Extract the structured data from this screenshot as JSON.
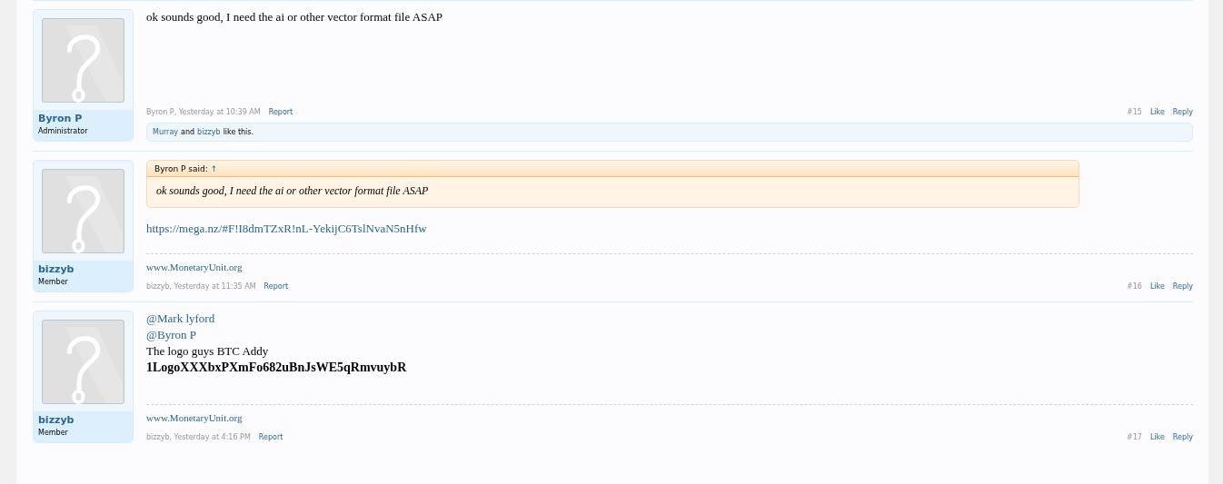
{
  "posts": [
    {
      "user": {
        "name": "Byron P",
        "role": "Administrator"
      },
      "body": [
        {
          "kind": "text",
          "text": "ok sounds good, I need the ai or other vector format file ASAP"
        }
      ],
      "meta": {
        "author": "Byron P, Yesterday at 10:39 AM",
        "report": "Report",
        "number": "#15",
        "like": "Like",
        "reply": "Reply"
      },
      "likes": {
        "first": "Murray",
        "and": "and",
        "second": "bizzyb",
        "tail": "like this."
      }
    },
    {
      "user": {
        "name": "bizzyb",
        "role": "Member"
      },
      "quote": {
        "attribution": "Byron P said:",
        "arrow": "↑",
        "text": "ok sounds good, I need the ai or other vector format file ASAP"
      },
      "body": [
        {
          "kind": "link",
          "text": "https://mega.nz/#F!I8dmTZxR!nL-YekijC6TslNvaN5nHfw"
        }
      ],
      "signature": "www.MonetaryUnit.org",
      "meta": {
        "author": "bizzyb, Yesterday at 11:35 AM",
        "report": "Report",
        "number": "#16",
        "like": "Like",
        "reply": "Reply"
      }
    },
    {
      "user": {
        "name": "bizzyb",
        "role": "Member"
      },
      "body": [
        {
          "kind": "mention",
          "text": "@Mark lyford"
        },
        {
          "kind": "mention",
          "text": "@Byron P"
        },
        {
          "kind": "text",
          "text": "The logo guys BTC Addy"
        },
        {
          "kind": "bold",
          "text": "1LogoXXXbxPXmFo682uBnJsWE5qRmvuybR"
        }
      ],
      "signature": "www.MonetaryUnit.org",
      "meta": {
        "author": "bizzyb, Yesterday at 4:16 PM",
        "report": "Report",
        "number": "#17",
        "like": "Like",
        "reply": "Reply"
      }
    }
  ]
}
